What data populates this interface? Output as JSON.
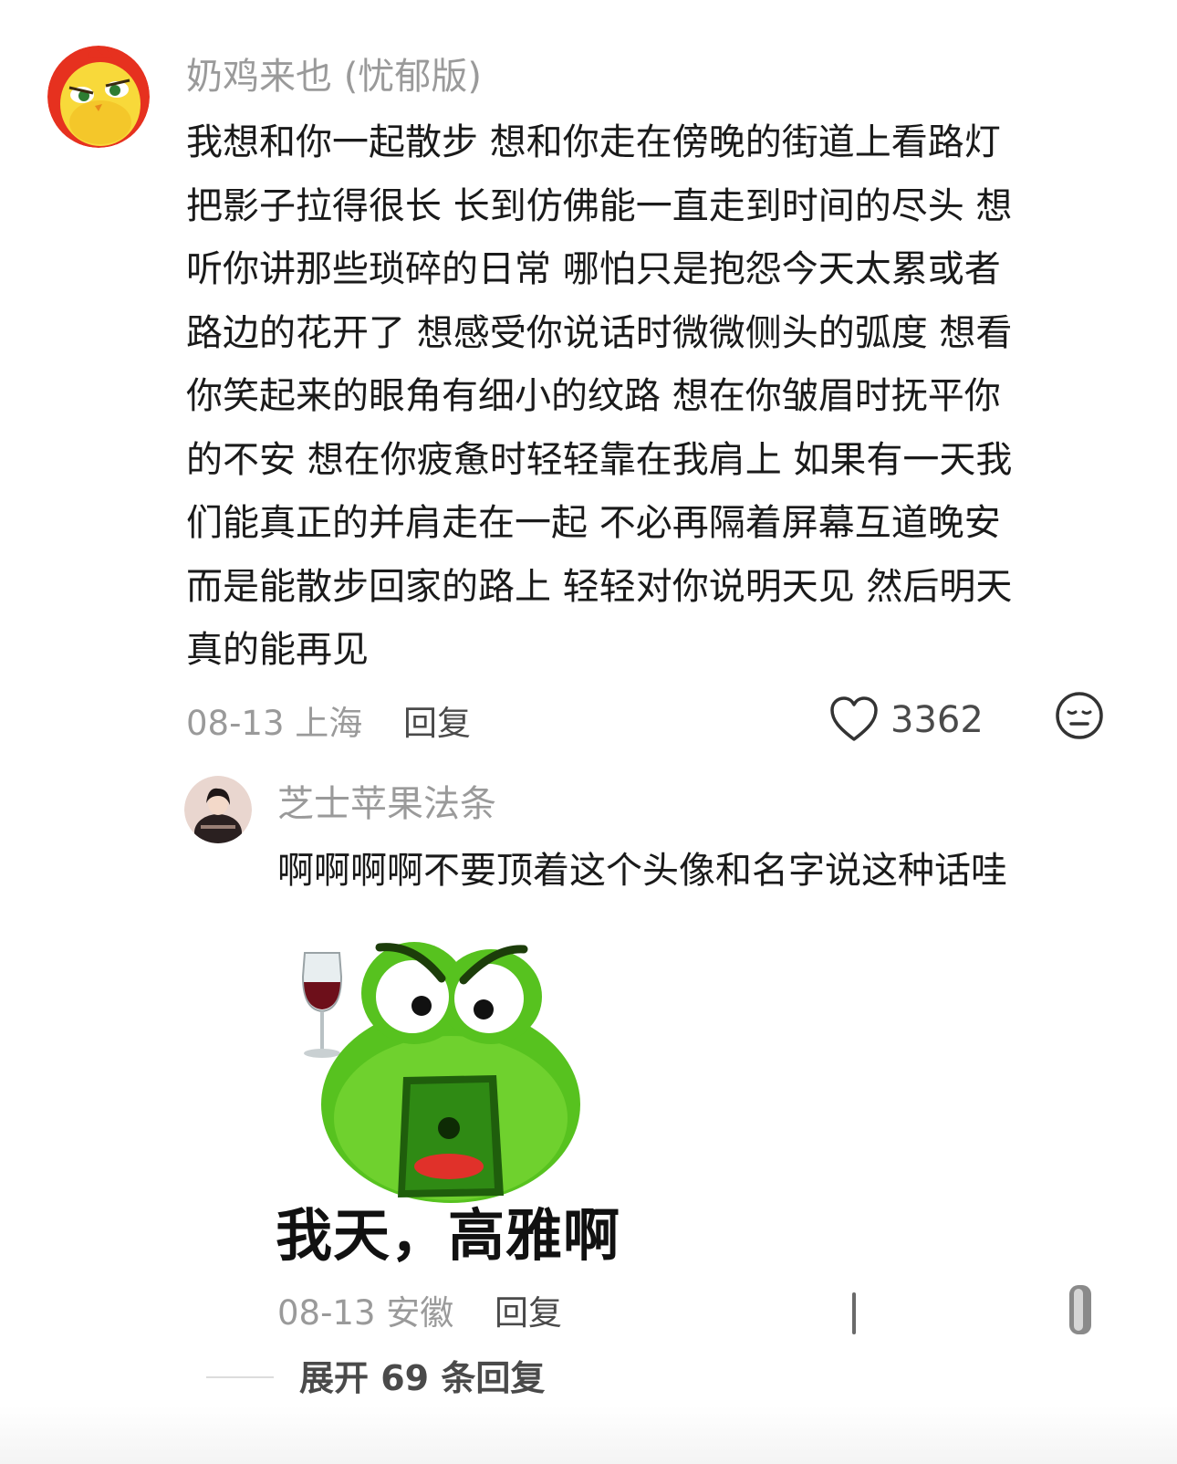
{
  "comment": {
    "avatar_icon": "yellow-chick-avatar",
    "username": "奶鸡来也 (忧郁版)",
    "lines": [
      "我想和你一起散步 想和你走在傍晚的街道上看路灯",
      "把影子拉得很长 长到仿佛能一直走到时间的尽头 想",
      "听你讲那些琐碎的日常 哪怕只是抱怨今天太累或者",
      "路边的花开了 想感受你说话时微微侧头的弧度 想看",
      "你笑起来的眼角有细小的纹路 想在你皱眉时抚平你",
      "的不安 想在你疲惫时轻轻靠在我肩上 如果有一天我",
      "们能真正的并肩走在一起 不必再隔着屏幕互道晚安",
      "而是能散步回家的路上 轻轻对你说明天见 然后明天",
      "真的能再见"
    ],
    "meta": "08-13 上海",
    "reply_label": "回复",
    "like_icon": "heart-outline-icon",
    "like_count": "3362",
    "dislike_icon": "meh-face-icon"
  },
  "reply": {
    "avatar_icon": "user-photo-avatar",
    "username": "芝士苹果法条",
    "text": "啊啊啊啊不要顶着这个头像和名字说这种话哇",
    "sticker": {
      "icon": "green-frog-wine-sticker",
      "caption": "我天，高雅啊"
    },
    "meta": "08-13 安徽",
    "reply_label": "回复"
  },
  "expand": {
    "label": "展开 69 条回复"
  },
  "colors": {
    "meta_gray": "#9a9a9a",
    "text_dark": "#1a1a1a",
    "action_gray": "#4a4a4a",
    "frog_green": "#57c21f",
    "chick_yellow": "#f8d93a",
    "avatar_red": "#e6311f"
  }
}
